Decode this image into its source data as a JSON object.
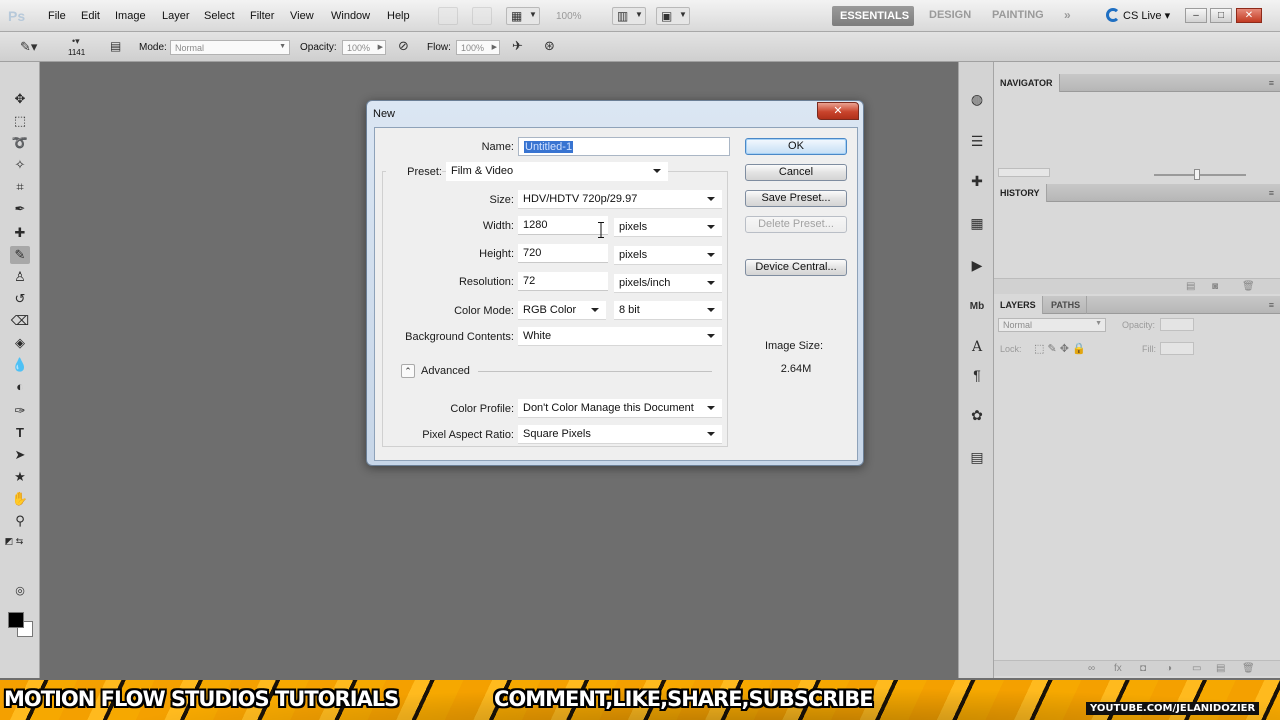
{
  "app": {
    "logo": "Ps"
  },
  "menu": [
    "File",
    "Edit",
    "Image",
    "Layer",
    "Select",
    "Filter",
    "View",
    "Window",
    "Help"
  ],
  "menubar": {
    "zoom": "100%",
    "cs_live": "CS Live"
  },
  "workspaces": {
    "active": "ESSENTIALS",
    "others": [
      "DESIGN",
      "PAINTING"
    ],
    "more": "»"
  },
  "window_controls": {
    "minimize": "‒",
    "restore": "□",
    "close": "✕"
  },
  "options": {
    "brush_size": "1141",
    "mode_label": "Mode:",
    "mode_value": "Normal",
    "opacity_label": "Opacity:",
    "opacity_value": "100%",
    "flow_label": "Flow:",
    "flow_value": "100%"
  },
  "panels": {
    "navigator": "NAVIGATOR",
    "history": "HISTORY",
    "layers": "LAYERS",
    "paths": "PATHS",
    "layers_blend": "Normal",
    "opacity_label": "Opacity:",
    "lock_label": "Lock:",
    "fill_label": "Fill:"
  },
  "dialog": {
    "title": "New",
    "close": "✕",
    "name_label": "Name:",
    "name_value": "Untitled-1",
    "preset_label": "Preset:",
    "preset_value": "Film & Video",
    "size_label": "Size:",
    "size_value": "HDV/HDTV 720p/29.97",
    "width_label": "Width:",
    "width_value": "1280",
    "width_unit": "pixels",
    "height_label": "Height:",
    "height_value": "720",
    "height_unit": "pixels",
    "resolution_label": "Resolution:",
    "resolution_value": "72",
    "resolution_unit": "pixels/inch",
    "color_mode_label": "Color Mode:",
    "color_mode_value": "RGB Color",
    "bit_depth_value": "8 bit",
    "background_label": "Background Contents:",
    "background_value": "White",
    "advanced_label": "Advanced",
    "color_profile_label": "Color Profile:",
    "color_profile_value": "Don't Color Manage this Document",
    "pixel_aspect_label": "Pixel Aspect Ratio:",
    "pixel_aspect_value": "Square Pixels",
    "buttons": {
      "ok": "OK",
      "cancel": "Cancel",
      "save_preset": "Save Preset...",
      "delete_preset": "Delete Preset...",
      "device_central": "Device Central..."
    },
    "image_size_label": "Image Size:",
    "image_size_value": "2.64M"
  },
  "banner": {
    "left": "MOTION FLOW STUDIOS TUTORIALS",
    "center": "COMMENT,LIKE,SHARE,SUBSCRIBE",
    "url": "YOUTUBE.COM/JELANIDOZIER"
  },
  "colors": {
    "accent_selection": "#3874d1",
    "banner_orange": "#f4a000",
    "dialog_frame": "#c7d6e8"
  }
}
